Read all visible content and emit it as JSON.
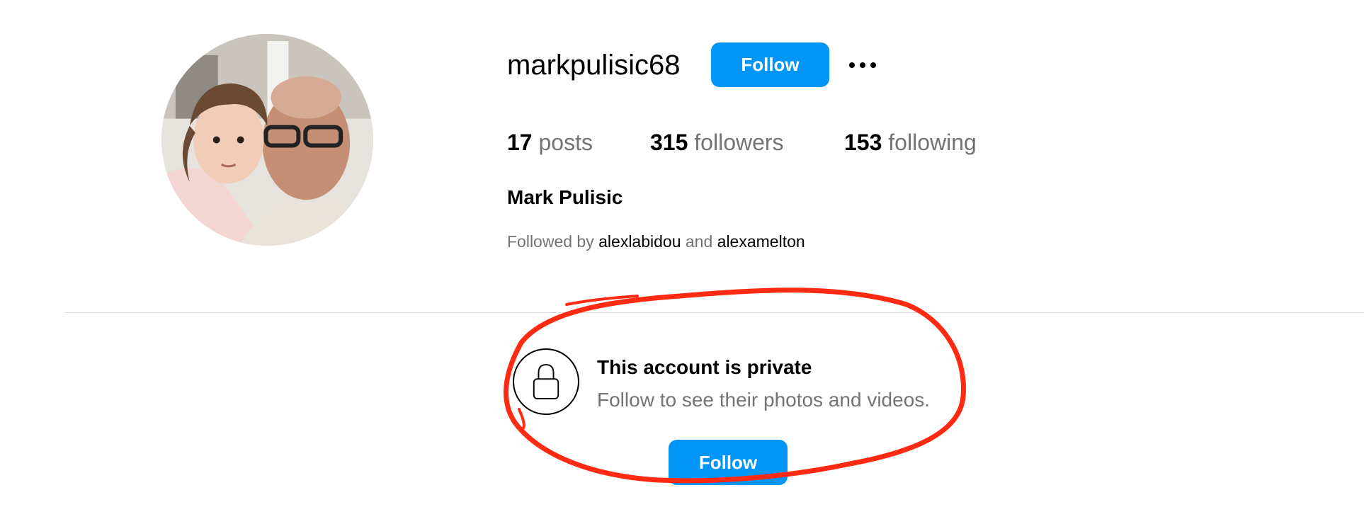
{
  "profile": {
    "username": "markpulisic68",
    "follow_label": "Follow",
    "more_icon": "more-horizontal-icon",
    "full_name": "Mark Pulisic",
    "avatar_alt": "profile-photo"
  },
  "stats": {
    "posts_count": "17",
    "posts_label": "posts",
    "followers_count": "315",
    "followers_label": "followers",
    "following_count": "153",
    "following_label": "following"
  },
  "followed_by": {
    "prefix": "Followed by",
    "user1": "alexlabidou",
    "joiner": "and",
    "user2": "alexamelton"
  },
  "private": {
    "icon": "lock-icon",
    "title": "This account is private",
    "subtitle": "Follow to see their photos and videos.",
    "follow_label": "Follow"
  },
  "colors": {
    "accent": "#0095f6",
    "muted_text": "#737373",
    "divider": "#dbdbdb",
    "annotation": "#ff2a12"
  }
}
